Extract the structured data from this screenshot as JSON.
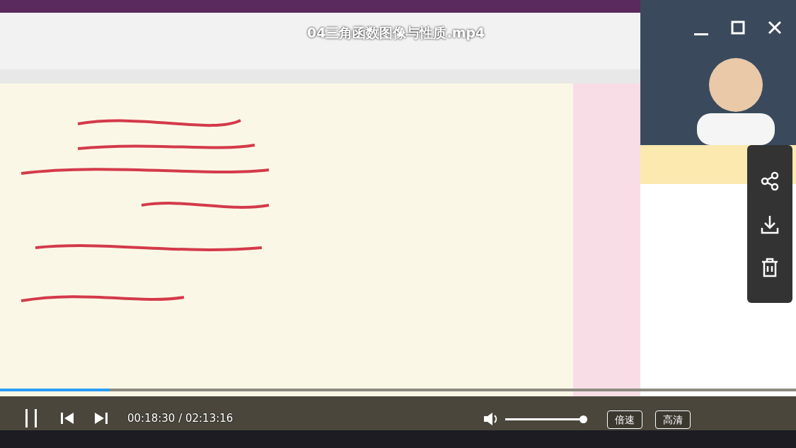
{
  "title": "04三角函数图像与性质.mp4",
  "progress": {
    "level": 0.138
  },
  "time": "00:18:30 / 02:13:16",
  "volume": {
    "level": 1
  },
  "buttons": [
    {
      "label": "倍速"
    },
    {
      "label": "高清"
    }
  ]
}
